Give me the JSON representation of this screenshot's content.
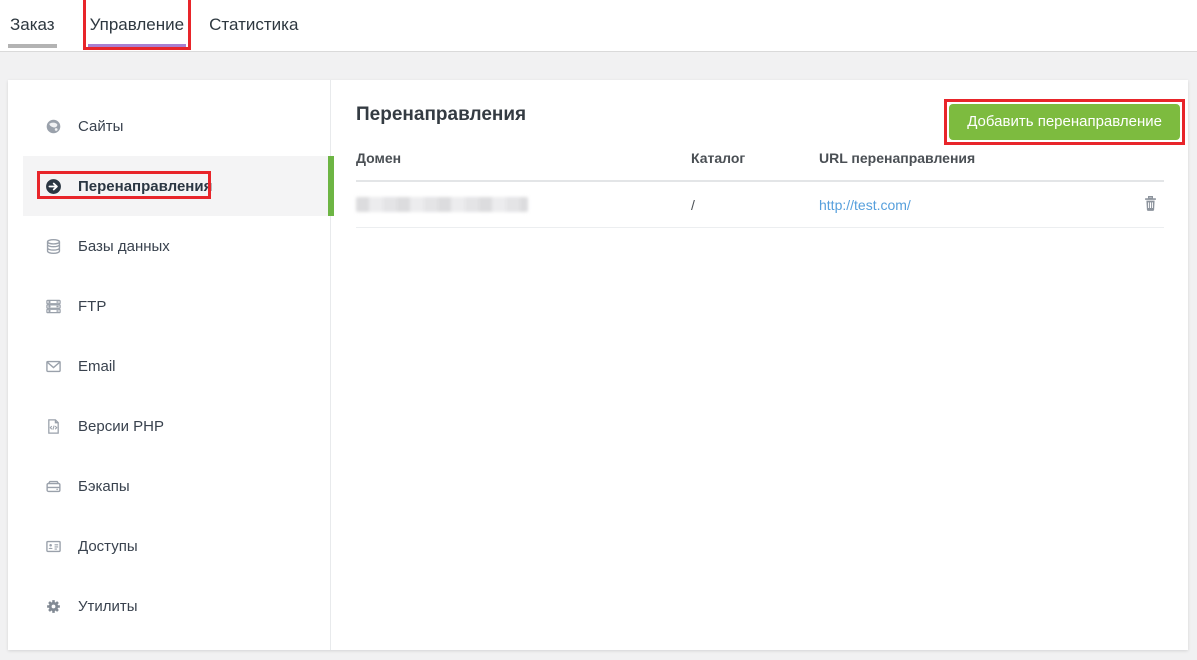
{
  "tabs": [
    {
      "label": "Заказ",
      "active": false,
      "annotated": false
    },
    {
      "label": "Управление",
      "active": true,
      "annotated": true
    },
    {
      "label": "Статистика",
      "active": false,
      "annotated": false
    }
  ],
  "sidebar": {
    "items": [
      {
        "label": "Сайты",
        "icon": "globe-icon",
        "active": false
      },
      {
        "label": "Перенаправления",
        "icon": "arrow-circle-right-icon",
        "active": true,
        "annotated": true
      },
      {
        "label": "Базы данных",
        "icon": "database-icon",
        "active": false
      },
      {
        "label": "FTP",
        "icon": "server-icon",
        "active": false
      },
      {
        "label": "Email",
        "icon": "envelope-icon",
        "active": false
      },
      {
        "label": "Версии PHP",
        "icon": "php-file-icon",
        "active": false
      },
      {
        "label": "Бэкапы",
        "icon": "hard-drive-icon",
        "active": false
      },
      {
        "label": "Доступы",
        "icon": "id-card-icon",
        "active": false
      },
      {
        "label": "Утилиты",
        "icon": "gear-icon",
        "active": false
      }
    ]
  },
  "main": {
    "title": "Перенаправления",
    "add_button_label": "Добавить перенаправление"
  },
  "table": {
    "columns": [
      "Домен",
      "Каталог",
      "URL перенаправления"
    ],
    "rows": [
      {
        "domain_redacted": true,
        "catalog": "/",
        "url": "http://test.com/"
      }
    ],
    "row_action_icon": "trash-icon"
  },
  "colors": {
    "accent_green": "#7dbb3f",
    "sidebar_active_green_bar": "#6db544",
    "annotation_red": "#e8252a",
    "active_tab_purple": "#a87fd0",
    "inactive_tab_gray": "#b3b3b3",
    "link_blue": "#569fdc"
  }
}
